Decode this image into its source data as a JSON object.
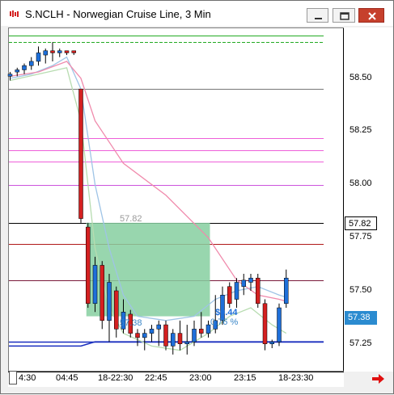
{
  "window": {
    "title": "S.NCLH - Norwegian Cruise Line, 3 Min",
    "buttons": [
      "minimize-button",
      "restore-button",
      "close-button"
    ]
  },
  "price_axis": {
    "ticks": [
      "58.50",
      "58.25",
      "58.00",
      "57.75",
      "57.50",
      "57.25"
    ],
    "badges": [
      {
        "value": "57.82",
        "bg": "#ffffff",
        "color": "#000000"
      },
      {
        "value": "57.38",
        "bg": "#2b8bd0",
        "color": "#ffffff"
      }
    ]
  },
  "time_axis": {
    "labels": [
      "4:30",
      "04:45",
      "18-22:30",
      "22:45",
      "23:00",
      "23:15",
      "18-23:30"
    ]
  },
  "overlays": {
    "entry_price_label": "57.82",
    "box_left_label": "57.38",
    "box_profit_label": "$0.44",
    "box_right_label": "0.76 %"
  },
  "colors": {
    "bull": "#1e6fd9",
    "bear": "#d42020",
    "profit_box": "#86cfa0",
    "green_line": "#22aa22",
    "pink_line": "#ee5fd9",
    "blue_line": "#1a2fbf"
  },
  "chart_data": {
    "type": "candlestick",
    "symbol": "S.NCLH",
    "interval": "3 Min",
    "ylim": [
      57.1,
      58.72
    ],
    "yticks": [
      58.5,
      58.25,
      58.0,
      57.75,
      57.5,
      57.25
    ],
    "candles": [
      {
        "o": 58.51,
        "h": 58.53,
        "l": 58.49,
        "c": 58.52
      },
      {
        "o": 58.53,
        "h": 58.55,
        "l": 58.51,
        "c": 58.54
      },
      {
        "o": 58.54,
        "h": 58.57,
        "l": 58.52,
        "c": 58.56
      },
      {
        "o": 58.56,
        "h": 58.6,
        "l": 58.54,
        "c": 58.58
      },
      {
        "o": 58.58,
        "h": 58.65,
        "l": 58.56,
        "c": 58.62
      },
      {
        "o": 58.61,
        "h": 58.64,
        "l": 58.57,
        "c": 58.63
      },
      {
        "o": 58.63,
        "h": 58.67,
        "l": 58.58,
        "c": 58.62
      },
      {
        "o": 58.62,
        "h": 58.64,
        "l": 58.6,
        "c": 58.63
      },
      {
        "o": 58.63,
        "h": 58.63,
        "l": 58.61,
        "c": 58.62
      },
      {
        "o": 58.63,
        "h": 58.63,
        "l": 58.61,
        "c": 58.62
      },
      {
        "o": 58.45,
        "h": 58.45,
        "l": 57.82,
        "c": 57.84
      },
      {
        "o": 57.8,
        "h": 57.82,
        "l": 57.42,
        "c": 57.44
      },
      {
        "o": 57.44,
        "h": 57.66,
        "l": 57.4,
        "c": 57.62
      },
      {
        "o": 57.62,
        "h": 57.64,
        "l": 57.32,
        "c": 57.36
      },
      {
        "o": 57.36,
        "h": 57.58,
        "l": 57.26,
        "c": 57.54
      },
      {
        "o": 57.5,
        "h": 57.52,
        "l": 57.28,
        "c": 57.32
      },
      {
        "o": 57.32,
        "h": 57.46,
        "l": 57.3,
        "c": 57.4
      },
      {
        "o": 57.39,
        "h": 57.41,
        "l": 57.28,
        "c": 57.3
      },
      {
        "o": 57.3,
        "h": 57.32,
        "l": 57.24,
        "c": 57.28
      },
      {
        "o": 57.28,
        "h": 57.32,
        "l": 57.22,
        "c": 57.3
      },
      {
        "o": 57.3,
        "h": 57.34,
        "l": 57.26,
        "c": 57.32
      },
      {
        "o": 57.32,
        "h": 57.36,
        "l": 57.24,
        "c": 57.34
      },
      {
        "o": 57.34,
        "h": 57.36,
        "l": 57.22,
        "c": 57.24
      },
      {
        "o": 57.24,
        "h": 57.32,
        "l": 57.2,
        "c": 57.3
      },
      {
        "o": 57.3,
        "h": 57.36,
        "l": 57.22,
        "c": 57.25
      },
      {
        "o": 57.25,
        "h": 57.34,
        "l": 57.2,
        "c": 57.26
      },
      {
        "o": 57.26,
        "h": 57.36,
        "l": 57.24,
        "c": 57.32
      },
      {
        "o": 57.32,
        "h": 57.4,
        "l": 57.28,
        "c": 57.3
      },
      {
        "o": 57.3,
        "h": 57.36,
        "l": 57.28,
        "c": 57.34
      },
      {
        "o": 57.32,
        "h": 57.48,
        "l": 57.3,
        "c": 57.36
      },
      {
        "o": 57.36,
        "h": 57.52,
        "l": 57.34,
        "c": 57.48
      },
      {
        "o": 57.52,
        "h": 57.54,
        "l": 57.42,
        "c": 57.44
      },
      {
        "o": 57.46,
        "h": 57.56,
        "l": 57.42,
        "c": 57.54
      },
      {
        "o": 57.52,
        "h": 57.58,
        "l": 57.48,
        "c": 57.55
      },
      {
        "o": 57.54,
        "h": 57.58,
        "l": 57.5,
        "c": 57.56
      },
      {
        "o": 57.56,
        "h": 57.58,
        "l": 57.42,
        "c": 57.44
      },
      {
        "o": 57.44,
        "h": 57.46,
        "l": 57.22,
        "c": 57.25
      },
      {
        "o": 57.25,
        "h": 57.27,
        "l": 57.23,
        "c": 57.26
      },
      {
        "o": 57.26,
        "h": 57.44,
        "l": 57.24,
        "c": 57.42
      },
      {
        "o": 57.44,
        "h": 57.6,
        "l": 57.42,
        "c": 57.56
      }
    ],
    "horizontal_lines": [
      {
        "y": 58.7,
        "color": "#22aa22",
        "style": "solid"
      },
      {
        "y": 58.67,
        "color": "#22aa22",
        "style": "dashed"
      },
      {
        "y": 58.45,
        "color": "#777777",
        "style": "solid"
      },
      {
        "y": 58.22,
        "color": "#ee5fd9",
        "style": "solid"
      },
      {
        "y": 58.16,
        "color": "#ee5fd9",
        "style": "solid"
      },
      {
        "y": 58.11,
        "color": "#ee5fd9",
        "style": "solid"
      },
      {
        "y": 58.0,
        "color": "#cc55dd",
        "style": "solid"
      },
      {
        "y": 57.82,
        "color": "#000000",
        "style": "solid"
      },
      {
        "y": 57.72,
        "color": "#b01818",
        "style": "solid"
      },
      {
        "y": 57.55,
        "color": "#7a1a3a",
        "style": "solid"
      },
      {
        "y": 57.26,
        "color": "#1a2fbf",
        "style": "solid"
      }
    ],
    "profit_box": {
      "start_index": 11,
      "end_index": 28,
      "top": 57.82,
      "bottom": 57.38
    }
  }
}
